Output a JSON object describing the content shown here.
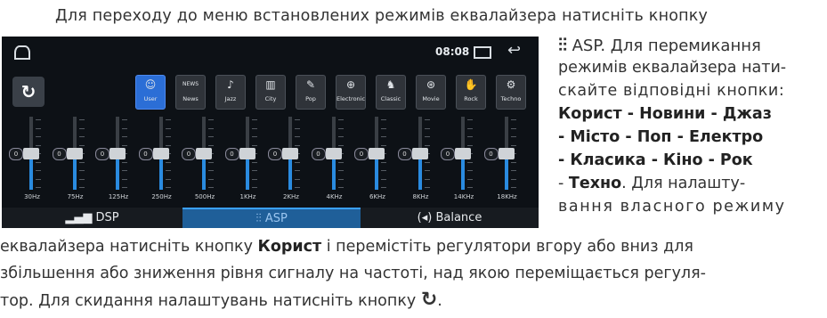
{
  "text": {
    "line1": "Для переходу до меню встановлених режимів еквалайзера натисніть кнопку",
    "r1_suffix": "ASP. Для перемикання",
    "r2": "режимів еквалайзера нати-",
    "r3": "скайте відповідні кнопки:",
    "r4": "Корист - Новини - Джаз",
    "r5": "- Місто - Поп - Електро",
    "r6": "- Класика - Кіно - Рок",
    "r7a": "- ",
    "r7b": "Техно",
    "r7c": ". Для налашту-",
    "r8": "вання власного режиму",
    "b1a": "еквалайзера натисніть кнопку ",
    "b1b": "Корист",
    "b1c": " і перемістіть регулятори вгору або вниз для",
    "b2": "збільшення або зниження рівня сигналу на частоті, над якою переміщається регуля-",
    "b3": "тор. Для скидання налаштувань натисніть кнопку"
  },
  "screen": {
    "time": "08:08",
    "modes": [
      {
        "label": "User",
        "icon": "☺",
        "active": true
      },
      {
        "label": "News",
        "icon": "NEWS"
      },
      {
        "label": "Jazz",
        "icon": "♪"
      },
      {
        "label": "City",
        "icon": "▥"
      },
      {
        "label": "Pop",
        "icon": "✎"
      },
      {
        "label": "Electronic",
        "icon": "⊕"
      },
      {
        "label": "Classic",
        "icon": "♞"
      },
      {
        "label": "Movie",
        "icon": "⊛"
      },
      {
        "label": "Rock",
        "icon": "✋"
      },
      {
        "label": "Techno",
        "icon": "⚙"
      }
    ],
    "bands": [
      {
        "freq": "30Hz",
        "gain": "0"
      },
      {
        "freq": "75Hz",
        "gain": "0"
      },
      {
        "freq": "125Hz",
        "gain": "0"
      },
      {
        "freq": "250Hz",
        "gain": "0"
      },
      {
        "freq": "500Hz",
        "gain": "0"
      },
      {
        "freq": "1KHz",
        "gain": "0"
      },
      {
        "freq": "2KHz",
        "gain": "0"
      },
      {
        "freq": "4KHz",
        "gain": "0"
      },
      {
        "freq": "6KHz",
        "gain": "0"
      },
      {
        "freq": "8KHz",
        "gain": "0"
      },
      {
        "freq": "14KHz",
        "gain": "0"
      },
      {
        "freq": "18KHz",
        "gain": "0"
      }
    ],
    "tabs": {
      "dsp": "DSP",
      "asp": "ASP",
      "balance": "Balance"
    }
  }
}
